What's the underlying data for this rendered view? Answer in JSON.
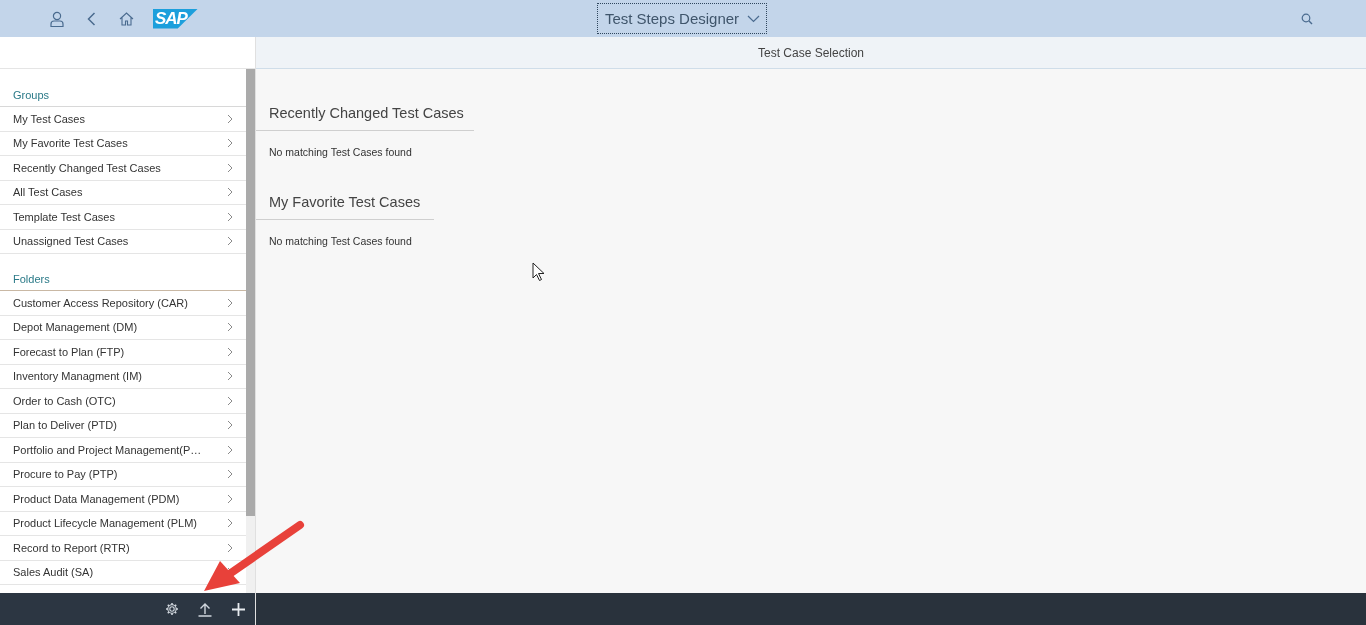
{
  "shell_bar": {
    "title": "Test Steps Designer",
    "logo": "SAP"
  },
  "page_header": {
    "title": "Test Case Selection"
  },
  "sidebar": {
    "sections": [
      {
        "title": "Groups",
        "items": [
          "My Test Cases",
          "My Favorite Test Cases",
          "Recently Changed Test Cases",
          "All Test Cases",
          "Template Test Cases",
          "Unassigned Test Cases"
        ]
      },
      {
        "title": "Folders",
        "items": [
          "Customer Access Repository (CAR)",
          "Depot Management (DM)",
          "Forecast to Plan (FTP)",
          "Inventory Managment (IM)",
          "Order to Cash (OTC)",
          "Plan to Deliver (PTD)",
          "Portfolio and Project Management(P…",
          "Procure to Pay (PTP)",
          "Product Data Management (PDM)",
          "Product Lifecycle Management (PLM)",
          "Record to Report (RTR)",
          "Sales Audit (SA)"
        ]
      }
    ]
  },
  "content": {
    "sections": [
      {
        "title": "Recently Changed Test Cases",
        "message": "No matching Test Cases found"
      },
      {
        "title": "My Favorite Test Cases",
        "message": "No matching Test Cases found"
      }
    ]
  }
}
